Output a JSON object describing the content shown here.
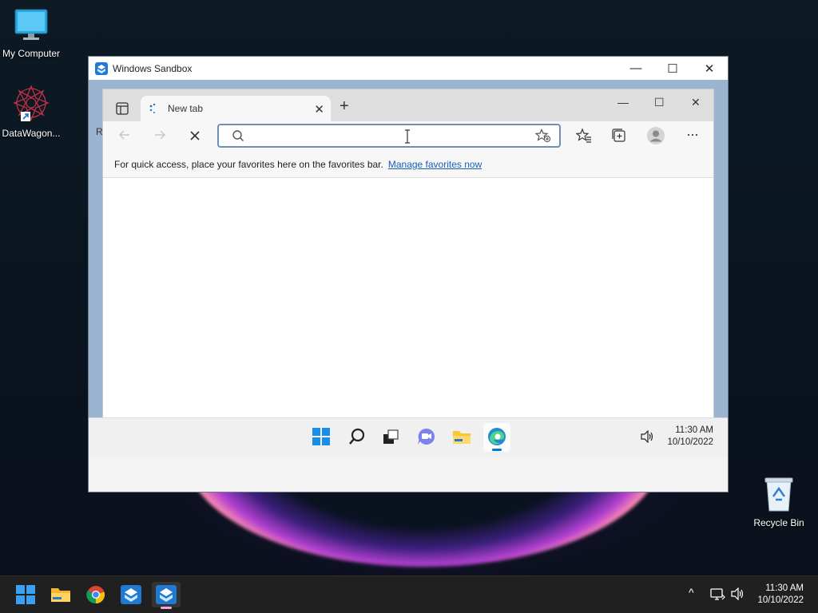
{
  "desktop": {
    "icons": [
      {
        "label": "My Computer",
        "icon": "monitor-icon"
      },
      {
        "label": "DataWagon...",
        "icon": "datawagon-icon"
      },
      {
        "label": "Recycle Bin",
        "icon": "recycle-bin-icon"
      }
    ]
  },
  "sandbox": {
    "title": "Windows Sandbox",
    "controls": {
      "minimize": "—",
      "maximize": "☐",
      "close": "✕"
    }
  },
  "browser": {
    "tab_label": "New tab",
    "tab_close": "✕",
    "new_tab": "+",
    "controls": {
      "minimize": "—",
      "maximize": "☐",
      "close": "✕"
    },
    "address": {
      "value": "",
      "placeholder": ""
    },
    "favorites_bar": {
      "text": "For quick access, place your favorites here on the favorites bar.",
      "link": "Manage favorites now"
    },
    "more": "···"
  },
  "sandbox_taskbar": {
    "time": "11:30 AM",
    "date": "10/10/2022"
  },
  "taskbar": {
    "time": "11:30 AM",
    "date": "10/10/2022",
    "apps": [
      "start-icon",
      "file-explorer-icon",
      "chrome-icon",
      "sandbox-icon",
      "sandbox-active-icon"
    ],
    "tray_chevron": "^"
  },
  "colors": {
    "accent": "#0078d4",
    "link": "#1a5fb4",
    "taskbar": "#202020"
  }
}
